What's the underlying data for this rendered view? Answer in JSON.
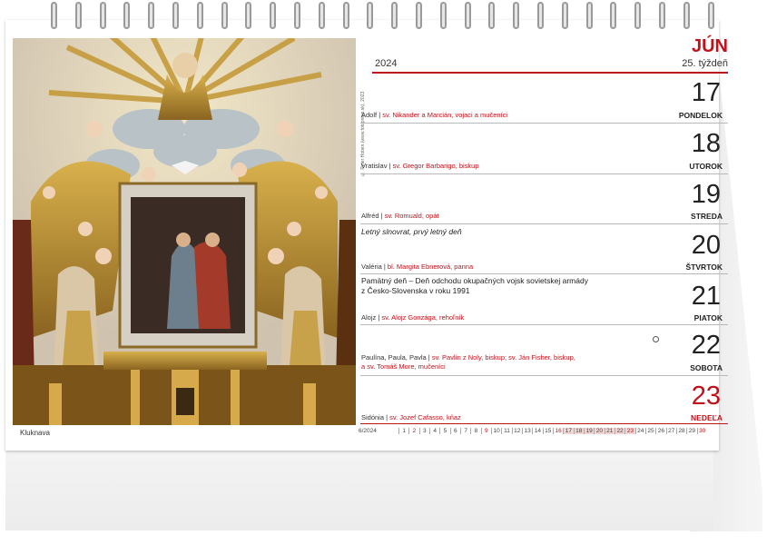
{
  "header": {
    "month": "JÚN",
    "year": "2024",
    "week": "25. týždeň"
  },
  "photo": {
    "caption": "Kluknava",
    "credit": "© Peter Hoben (www.fotoprees.sk), 2023"
  },
  "days": [
    {
      "number": "17",
      "name": "PONDELOK",
      "names": "Adolf",
      "saint": "sv. Nikander a Marcián, vojaci a mučeníci",
      "note": ""
    },
    {
      "number": "18",
      "name": "UTOROK",
      "names": "Vratislav",
      "saint": "sv. Gregor Barbarigo, biskup",
      "note": ""
    },
    {
      "number": "19",
      "name": "STREDA",
      "names": "Alfréd",
      "saint": "sv. Romuald, opát",
      "note": ""
    },
    {
      "number": "20",
      "name": "ŠTVRTOK",
      "names": "Valéria",
      "saint": "bl. Margita Ebnerová, panna",
      "note": "Letný slnovrat, prvý letný deň"
    },
    {
      "number": "21",
      "name": "PIATOK",
      "names": "Alojz",
      "saint": "sv. Alojz Gonzága, rehoľník",
      "note_line1": "Pamätný deň – Deň odchodu okupačných vojsk sovietskej armády",
      "note_line2": "z Česko-Slovenska v roku 1991"
    },
    {
      "number": "22",
      "name": "SOBOTA",
      "names": "Paulína, Paula, Pavla",
      "saint": "sv. Pavlín z Noly, biskup; sv. Ján Fisher, biskup,",
      "saint2": "a sv. Tomáš More, mučeníci",
      "note": ""
    },
    {
      "number": "23",
      "name": "NEDEĽA",
      "names": "Sidónia",
      "saint": "sv. Jozef Cafasso, kňaz",
      "note": ""
    }
  ],
  "mini_calendar": {
    "label": "6/2024",
    "days": [
      "1",
      "2",
      "3",
      "4",
      "5",
      "6",
      "7",
      "8",
      "9",
      "10",
      "11",
      "12",
      "13",
      "14",
      "15",
      "16",
      "17",
      "18",
      "19",
      "20",
      "21",
      "22",
      "23",
      "24",
      "25",
      "26",
      "27",
      "28",
      "29",
      "30"
    ],
    "red_days": [
      "2",
      "9",
      "16",
      "23",
      "30"
    ],
    "highlighted_days": [
      "17",
      "18",
      "19",
      "20",
      "21",
      "22",
      "23"
    ]
  },
  "colors": {
    "accent": "#c0121b",
    "rule": "#b9b9b9"
  }
}
